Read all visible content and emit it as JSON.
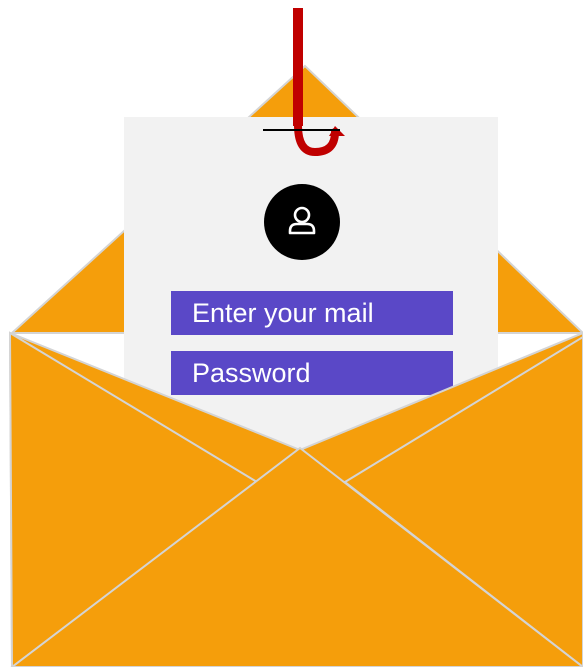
{
  "login": {
    "email_placeholder": "Enter your mail",
    "password_placeholder": "Password"
  },
  "icons": {
    "envelope": "open-envelope-icon",
    "hook": "fishing-hook-icon",
    "avatar": "user-icon"
  },
  "colors": {
    "envelope": "#f59e0b",
    "envelope_edge": "#d4d4d4",
    "letter": "#f2f2f2",
    "field": "#5a48c7",
    "hook": "#c00000",
    "avatar_bg": "#000000",
    "avatar_fg": "#ffffff",
    "text": "#ffffff"
  }
}
